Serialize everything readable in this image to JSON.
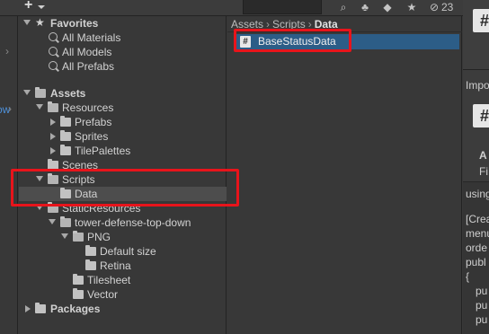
{
  "toolbar": {
    "add_label": "+",
    "icons": [
      "search-icon",
      "type-filter-icon",
      "label-filter-icon",
      "favorite-icon",
      "hidden-icon"
    ],
    "hidden_count": "23"
  },
  "left_sliver": {
    "fragment": "ow"
  },
  "tree": {
    "favorites": {
      "label": "Favorites",
      "items": [
        "All Materials",
        "All Models",
        "All Prefabs"
      ]
    },
    "assets": {
      "label": "Assets",
      "resources": "Resources",
      "prefabs": "Prefabs",
      "sprites": "Sprites",
      "tilepalettes": "TilePalettes",
      "scenes": "Scenes",
      "scripts": "Scripts",
      "data": "Data",
      "static_resources": "StaticResources",
      "tower_defense": "tower-defense-top-down",
      "png": "PNG",
      "default_size": "Default size",
      "retina": "Retina",
      "tilesheet": "Tilesheet",
      "vector": "Vector"
    },
    "packages": "Packages"
  },
  "content": {
    "breadcrumb": [
      "Assets",
      "Scripts",
      "Data"
    ],
    "files": [
      {
        "name": "BaseStatusData",
        "icon": "csharp-script-icon",
        "selected": true
      }
    ]
  },
  "inspector": {
    "header_hash": "#",
    "import_label": "Impo",
    "sub_hash": "#",
    "asset_label": "A",
    "file_label": "Fi",
    "code_lines": [
      "using",
      "",
      "[Crea",
      "menu",
      "orde",
      "publ",
      "{",
      "pu",
      "pu",
      "pu"
    ]
  },
  "colors": {
    "background": "#383838",
    "selection": "#2c5d87",
    "highlight_box": "#e8141b",
    "tree_selected": "#4d4d4d"
  }
}
